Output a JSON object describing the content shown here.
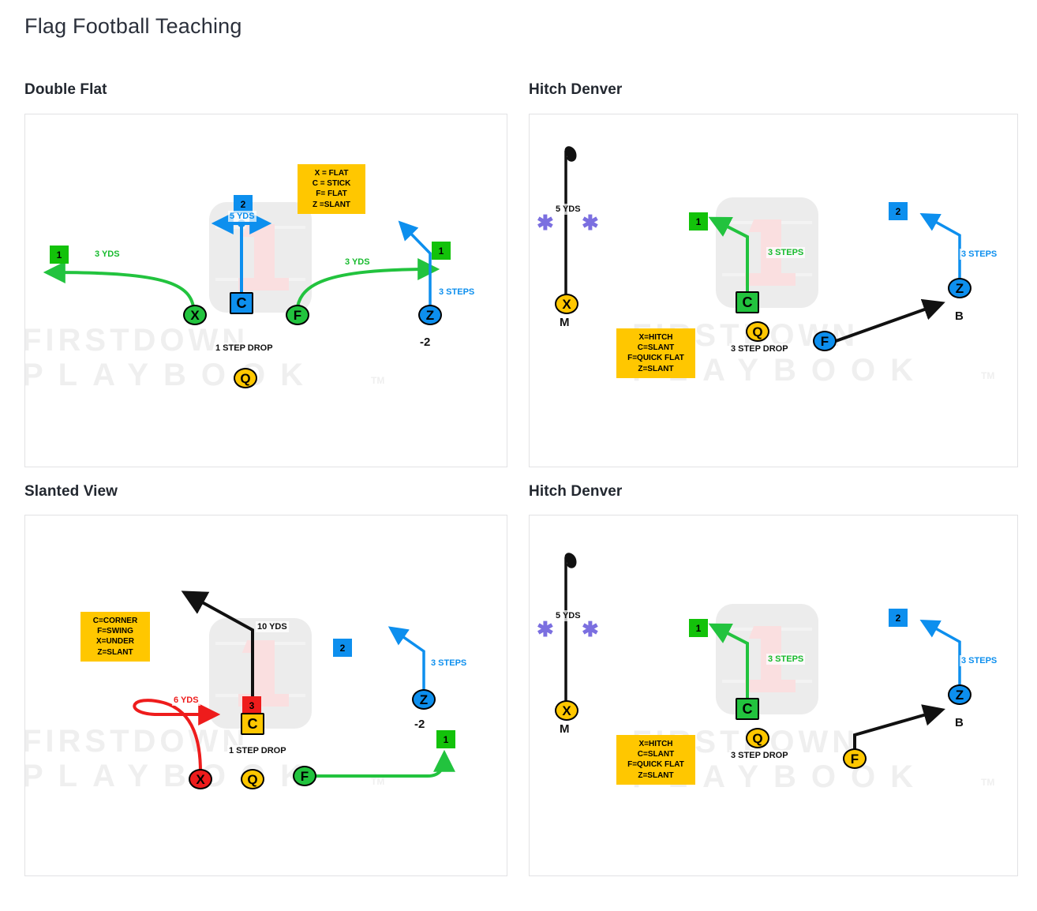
{
  "page": {
    "title": "Flag Football Teaching",
    "watermark": {
      "line1": "FIRSTDOWN",
      "line2": "PLAYBOOK",
      "tm": "TM"
    }
  },
  "panels": [
    {
      "id": "double-flat",
      "title": "Double Flat",
      "legend": "X = FLAT\nC = STICK\nF= FLAT\nZ =SLANT",
      "players": [
        {
          "label": "X",
          "color": "green",
          "shape": "circle"
        },
        {
          "label": "C",
          "color": "blue",
          "shape": "square"
        },
        {
          "label": "F",
          "color": "green",
          "shape": "circle"
        },
        {
          "label": "Z",
          "color": "blue",
          "shape": "circle"
        },
        {
          "label": "Q",
          "color": "yellow",
          "shape": "circle"
        }
      ],
      "chips": [
        {
          "number": "1",
          "color": "green"
        },
        {
          "number": "2",
          "color": "blue"
        },
        {
          "number": "1",
          "color": "green"
        }
      ],
      "labels": [
        {
          "text": "3 YDS",
          "color": "green"
        },
        {
          "text": "5 YDS",
          "color": "blue"
        },
        {
          "text": "3 YDS",
          "color": "green"
        },
        {
          "text": "3 STEPS",
          "color": "blue"
        },
        {
          "text": "1 STEP DROP",
          "color": "black"
        },
        {
          "text": "-2",
          "color": "black"
        }
      ]
    },
    {
      "id": "hitch-denver-top",
      "title": "Hitch Denver",
      "legend": "X=HITCH\nC=SLANT\nF=QUICK FLAT\nZ=SLANT",
      "players": [
        {
          "label": "X",
          "color": "yellow",
          "shape": "circle"
        },
        {
          "label": "C",
          "color": "green",
          "shape": "square"
        },
        {
          "label": "Q",
          "color": "yellow",
          "shape": "circle"
        },
        {
          "label": "F",
          "color": "blue",
          "shape": "circle"
        },
        {
          "label": "Z",
          "color": "blue",
          "shape": "circle"
        }
      ],
      "chips": [
        {
          "number": "1",
          "color": "green"
        },
        {
          "number": "2",
          "color": "blue"
        }
      ],
      "labels": [
        {
          "text": "5 YDS",
          "color": "black"
        },
        {
          "text": "M",
          "color": "black"
        },
        {
          "text": "3 STEPS",
          "color": "green"
        },
        {
          "text": "3 STEP DROP",
          "color": "black"
        },
        {
          "text": "3 STEPS",
          "color": "blue"
        },
        {
          "text": "B",
          "color": "black"
        }
      ]
    },
    {
      "id": "slanted-view",
      "title": "Slanted View",
      "legend": "C=CORNER\nF=SWING\nX=UNDER\nZ=SLANT",
      "players": [
        {
          "label": "X",
          "color": "red",
          "shape": "circle"
        },
        {
          "label": "C",
          "color": "yellow",
          "shape": "square"
        },
        {
          "label": "Q",
          "color": "yellow",
          "shape": "circle"
        },
        {
          "label": "F",
          "color": "green",
          "shape": "circle"
        },
        {
          "label": "Z",
          "color": "blue",
          "shape": "circle"
        }
      ],
      "chips": [
        {
          "number": "3",
          "color": "red"
        },
        {
          "number": "2",
          "color": "blue"
        },
        {
          "number": "1",
          "color": "green"
        }
      ],
      "labels": [
        {
          "text": "10 YDS",
          "color": "black"
        },
        {
          "text": "6 YDS",
          "color": "red"
        },
        {
          "text": "1 STEP DROP",
          "color": "black"
        },
        {
          "text": "3 STEPS",
          "color": "blue"
        },
        {
          "text": "-2",
          "color": "black"
        }
      ]
    },
    {
      "id": "hitch-denver-bottom",
      "title": "Hitch Denver",
      "legend": "X=HITCH\nC=SLANT\nF=QUICK FLAT\nZ=SLANT",
      "players": [
        {
          "label": "X",
          "color": "yellow",
          "shape": "circle"
        },
        {
          "label": "C",
          "color": "green",
          "shape": "square"
        },
        {
          "label": "Q",
          "color": "yellow",
          "shape": "circle"
        },
        {
          "label": "F",
          "color": "yellow",
          "shape": "circle"
        },
        {
          "label": "Z",
          "color": "blue",
          "shape": "circle"
        }
      ],
      "chips": [
        {
          "number": "1",
          "color": "green"
        },
        {
          "number": "2",
          "color": "blue"
        }
      ],
      "labels": [
        {
          "text": "5 YDS",
          "color": "black"
        },
        {
          "text": "M",
          "color": "black"
        },
        {
          "text": "3 STEPS",
          "color": "green"
        },
        {
          "text": "3 STEP DROP",
          "color": "black"
        },
        {
          "text": "3 STEPS",
          "color": "blue"
        },
        {
          "text": "B",
          "color": "black"
        }
      ]
    }
  ],
  "colors": {
    "green": "#22c33e",
    "blue": "#0d8fee",
    "yellow": "#ffc700",
    "red": "#ee1c1c",
    "black": "#111111",
    "purple": "#7b6fe0",
    "panel_border": "#e2e2e4",
    "watermark": "#efefef"
  }
}
